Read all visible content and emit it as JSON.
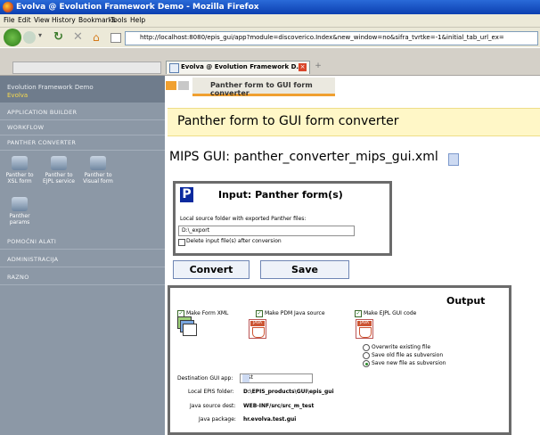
{
  "window": {
    "title": "Evolva @ Evolution Framework Demo - Mozilla Firefox"
  },
  "menu": [
    "File",
    "Edit",
    "View",
    "History",
    "Bookmarks",
    "Tools",
    "Help"
  ],
  "nav": {
    "url": "http://localhost:8080/epis_gui/app?module=discoverico.Index&new_window=no&sifra_tvrtke=-1&initial_tab_url_ex="
  },
  "tabs": [
    {
      "label": "Evolva @ Evolution Framework D...",
      "close": "×"
    }
  ],
  "tab_plus": "+",
  "sidebar": {
    "app_name": "Evolution Framework Demo",
    "app_sub": "Evolva",
    "items_top": [
      "APPLICATION BUILDER",
      "WORKFLOW",
      "PANTHER CONVERTER"
    ],
    "icons": [
      {
        "label": "Panther to XSL form",
        "icon": "gears-icon"
      },
      {
        "label": "Panther to EJPL service",
        "icon": "gears-icon"
      },
      {
        "label": "Panther to Visual form",
        "icon": "gears-icon"
      },
      {
        "label": "Panther params",
        "icon": "params-icon"
      }
    ],
    "items_bottom": [
      "POMOĆNI ALATI",
      "ADMINISTRACIJA",
      "RAZNO"
    ]
  },
  "content": {
    "tab_label": "Panther form to GUI form converter",
    "page_title": "Panther form to GUI form converter",
    "gui_select": "MIPS GUI: panther_converter_mips_gui.xml"
  },
  "input": {
    "title": "Input: Panther form(s)",
    "folder_label": "Local source folder with exported Panther files:",
    "folder_value": "D:\\_export",
    "delete_label": "Delete input file(s) after conversion"
  },
  "buttons": {
    "convert": "Convert",
    "save": "Save"
  },
  "output": {
    "title": "Output",
    "make_form_xml": "Make Form XML",
    "make_pdm": "Make PDM Java source",
    "make_ejpl": "Make EJPL GUI code",
    "radio_options": [
      "Overwrite existing file",
      "Save old file as subversion",
      "Save new file as subversion"
    ],
    "dest_label": "Destination GUI app:",
    "dest_value": "Test",
    "epis_folder_label": "Local EPIS folder:",
    "epis_folder_value": "D:\\EPIS_products\\GUI\\epis_gui",
    "java_dest_label": "Java source dest:",
    "java_dest_value": "WEB-INF/src/src_m_test",
    "java_pkg_label": "Java package:",
    "java_pkg_value": "hr.evolva.test.gui",
    "java_icon_label": "JAVA"
  }
}
